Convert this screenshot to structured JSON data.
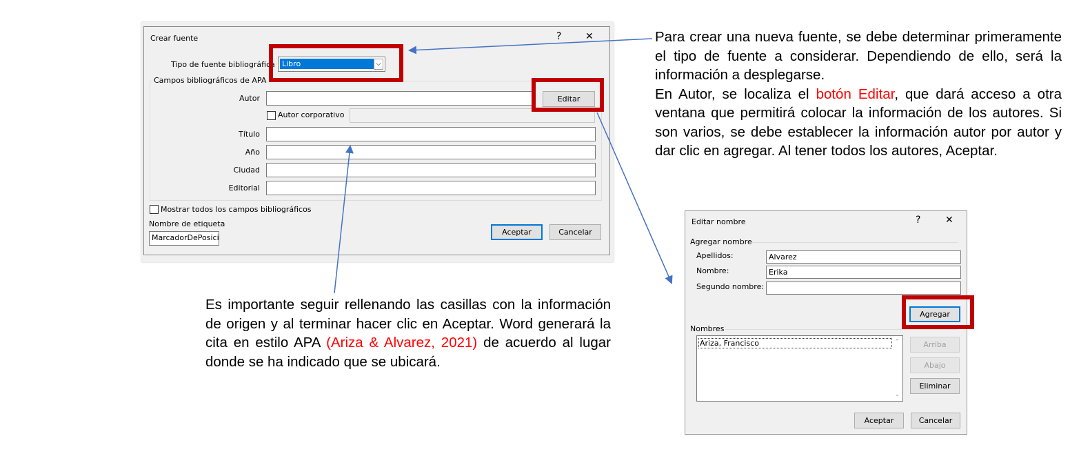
{
  "dialog_source": {
    "title": "Crear fuente",
    "help": "?",
    "close": "✕",
    "source_type_label": "Tipo de fuente bibliográfica",
    "source_type_value": "Libro",
    "group_label": "Campos bibliográficos de APA",
    "author_label": "Autor",
    "edit_button": "Editar",
    "corporate_author_label": "Autor corporativo",
    "title_label": "Título",
    "year_label": "Año",
    "city_label": "Ciudad",
    "publisher_label": "Editorial",
    "show_all_label": "Mostrar todos los campos bibliográficos",
    "tag_name_label": "Nombre de etiqueta",
    "tag_name_value": "MarcadorDePosicio",
    "ok_button": "Aceptar",
    "cancel_button": "Cancelar"
  },
  "dialog_name": {
    "title": "Editar nombre",
    "help": "?",
    "close": "✕",
    "add_name_label": "Agregar nombre",
    "last_name_label": "Apellidos:",
    "last_name_value": "Alvarez",
    "first_name_label": "Nombre:",
    "first_name_value": "Erika",
    "middle_name_label": "Segundo nombre:",
    "middle_name_value": "",
    "add_button": "Agregar",
    "names_label": "Nombres",
    "names": [
      "Ariza, Francisco"
    ],
    "up_button": "Arriba",
    "down_button": "Abajo",
    "delete_button": "Eliminar",
    "ok_button": "Aceptar",
    "cancel_button": "Cancelar"
  },
  "text_right": {
    "p1": "Para crear una nueva fuente, se debe determinar primeramente el tipo de fuente a considerar. Dependiendo de ello, será la información a desplegarse.",
    "p2_a": "En Autor, se localiza el ",
    "p2_highlight": "botón Editar",
    "p2_b": ", que dará acceso a otra ventana que permitirá colocar la información de los autores. Si son varios, se debe establecer la información autor por autor y dar clic en agregar. Al tener todos los autores, Aceptar."
  },
  "text_bottom": {
    "a": "Es importante seguir rellenando las casillas con la información de origen y al terminar hacer clic en Aceptar. Word generará la cita en estilo APA ",
    "citation": " (Ariza & Alvarez, 2021) ",
    "b": " de acuerdo al lugar donde se ha indicado que se ubicará."
  },
  "colors": {
    "highlight_box": "#c00000",
    "arrow": "#4472c4",
    "citation_text": "#ff0000",
    "select_highlight": "#0078d7"
  }
}
